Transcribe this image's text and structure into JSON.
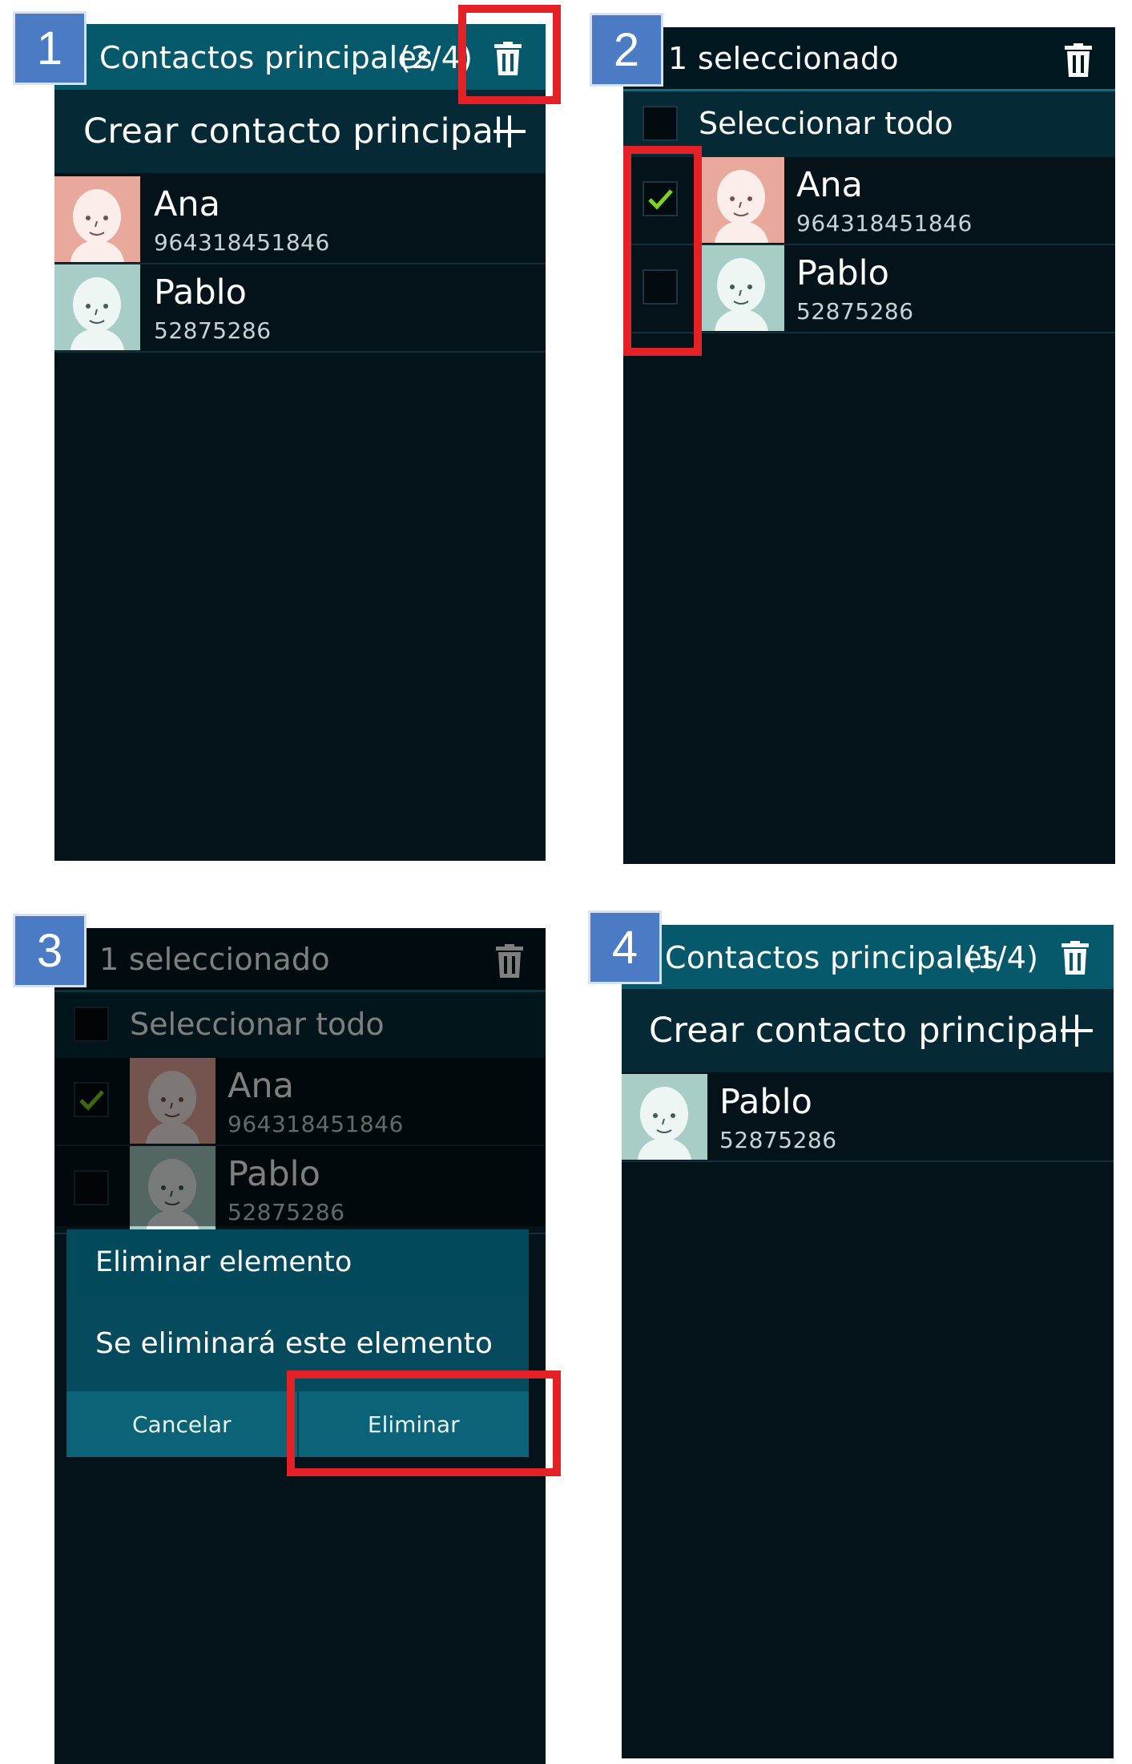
{
  "steps": [
    "1",
    "2",
    "3",
    "4"
  ],
  "colors": {
    "header_teal": "#06596b",
    "row_teal": "#052a36",
    "screen_bg": "#04121a",
    "step_badge": "#4a7bc4",
    "highlight_red": "#e32127",
    "check_green": "#7ed321",
    "avatar_ana": "#e8a99c",
    "avatar_pablo": "#a8cdc6"
  },
  "screen1": {
    "title": "Contactos principales",
    "count": "(2/4)",
    "create_label": "Crear contacto principal",
    "contacts": [
      {
        "name": "Ana",
        "number": "964318451846"
      },
      {
        "name": "Pablo",
        "number": "52875286"
      }
    ]
  },
  "screen2": {
    "title": "1 seleccionado",
    "select_all": "Seleccionar todo",
    "contacts": [
      {
        "name": "Ana",
        "number": "964318451846",
        "checked": true
      },
      {
        "name": "Pablo",
        "number": "52875286",
        "checked": false
      }
    ]
  },
  "screen3": {
    "title": "1 seleccionado",
    "select_all": "Seleccionar todo",
    "contacts": [
      {
        "name": "Ana",
        "number": "964318451846",
        "checked": true
      },
      {
        "name": "Pablo",
        "number": "52875286",
        "checked": false
      }
    ],
    "dialog": {
      "title": "Eliminar elemento",
      "message": "Se eliminará este elemento",
      "cancel": "Cancelar",
      "confirm": "Eliminar"
    }
  },
  "screen4": {
    "title": "Contactos principales",
    "count": "(1/4)",
    "create_label": "Crear contacto principal",
    "contacts": [
      {
        "name": "Pablo",
        "number": "52875286"
      }
    ]
  }
}
